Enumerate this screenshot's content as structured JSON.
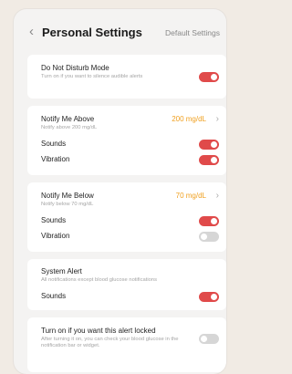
{
  "header": {
    "back_icon": "chevron-left-icon",
    "title": "Personal Settings",
    "default_link": "Default Settings"
  },
  "dnd": {
    "label": "Do Not Disturb Mode",
    "hint": "Turn on if you want to silence audible alerts",
    "enabled": true
  },
  "notify_above": {
    "label": "Notify Me Above",
    "hint": "Notify above 200 mg/dL",
    "value": "200 mg/dL",
    "sounds_label": "Sounds",
    "sounds_on": true,
    "vibration_label": "Vibration",
    "vibration_on": true
  },
  "notify_below": {
    "label": "Notify Me Below",
    "hint": "Notify below 70 mg/dL",
    "value": "70 mg/dL",
    "sounds_label": "Sounds",
    "sounds_on": true,
    "vibration_label": "Vibration",
    "vibration_on": false
  },
  "system_alert": {
    "label": "System Alert",
    "hint": "All notifications except blood glucose notifications",
    "sounds_label": "Sounds",
    "sounds_on": true
  },
  "lock_alert": {
    "label": "Turn on if you want this alert locked",
    "hint": "After turning it on, you can check your blood glucose in the notification bar or widget.",
    "enabled": false
  },
  "colors": {
    "accent": "#e04a4a",
    "value": "#f0a020",
    "toggle_off": "#d6d6d6",
    "page_bg": "#f1ebe4",
    "panel_bg": "#f4f3f2"
  }
}
